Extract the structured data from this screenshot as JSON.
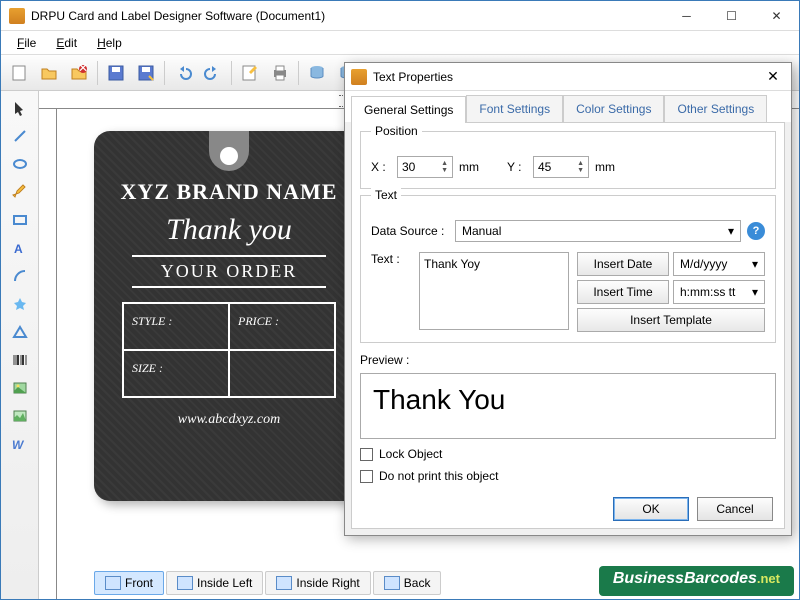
{
  "window": {
    "title": "DRPU Card and Label Designer Software (Document1)"
  },
  "menu": {
    "file": "File",
    "edit": "Edit",
    "help": "Help"
  },
  "pages": {
    "front": "Front",
    "inside_left": "Inside Left",
    "inside_right": "Inside Right",
    "back": "Back"
  },
  "card": {
    "brand": "XYZ BRAND NAME",
    "thank": "Thank you",
    "order": "YOUR ORDER",
    "style_label": "STYLE :",
    "price_label": "PRICE :",
    "size_label": "SIZE :",
    "url": "www.abcdxyz.com"
  },
  "dialog": {
    "title": "Text Properties",
    "tabs": {
      "general": "General Settings",
      "font": "Font Settings",
      "color": "Color Settings",
      "other": "Other Settings"
    },
    "position_label": "Position",
    "x_label": "X :",
    "x_value": "30",
    "x_unit": "mm",
    "y_label": "Y :",
    "y_value": "45",
    "y_unit": "mm",
    "text_label": "Text",
    "data_source_label": "Data Source :",
    "data_source_value": "Manual",
    "text_field_label": "Text :",
    "text_field_value": "Thank Yoy",
    "insert_date": "Insert Date",
    "date_format": "M/d/yyyy",
    "insert_time": "Insert Time",
    "time_format": "h:mm:ss tt",
    "insert_template": "Insert Template",
    "preview_label": "Preview :",
    "preview_value": "Thank You",
    "lock_object": "Lock Object",
    "do_not_print": "Do not print this object",
    "ok": "OK",
    "cancel": "Cancel"
  },
  "watermark": {
    "brand": "BusinessBarcodes",
    "tld": ".net"
  }
}
